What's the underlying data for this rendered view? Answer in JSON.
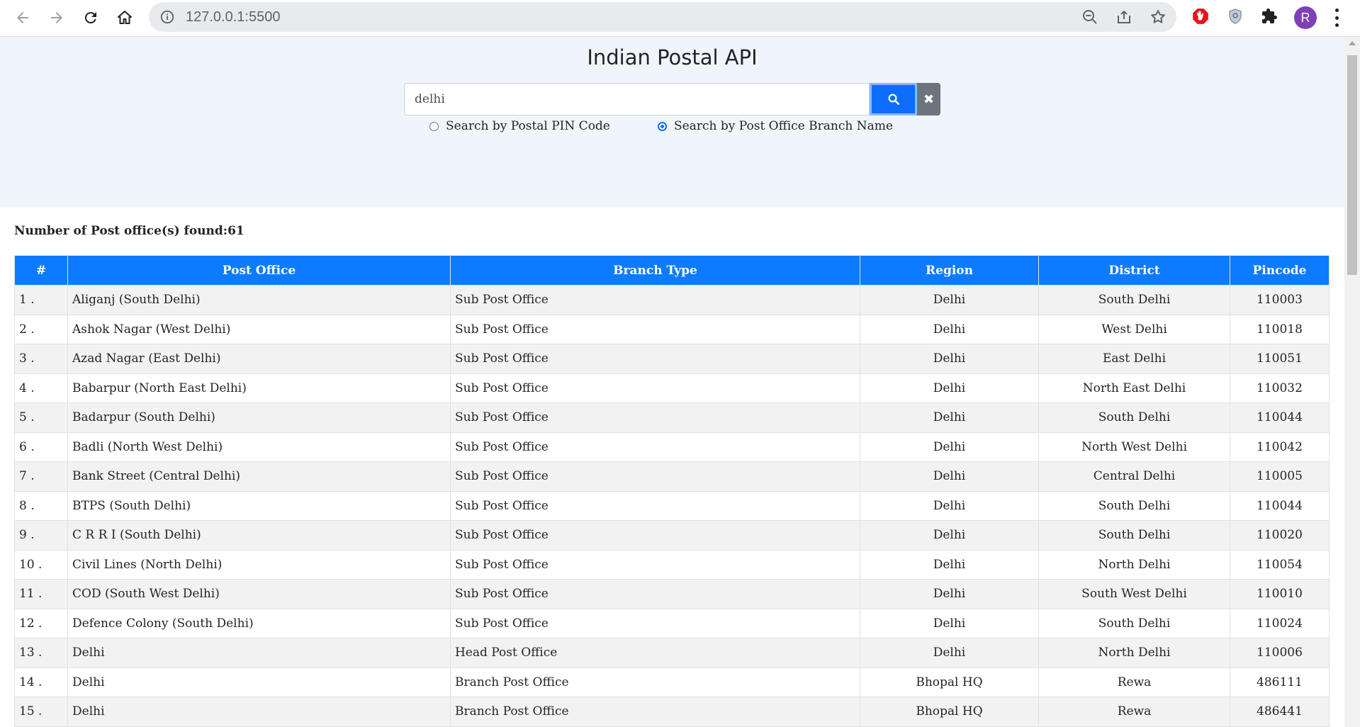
{
  "browser": {
    "url": "127.0.0.1:5500",
    "profile_initial": "R"
  },
  "page": {
    "title": "Indian Postal API",
    "search": {
      "value": "delhi",
      "radio_pin_label": "Search by Postal PIN Code",
      "radio_name_label": "Search by Post Office Branch Name",
      "selected": "name"
    },
    "results_label": "Number of Post office(s) found:",
    "results_count": "61",
    "table": {
      "headers": [
        "#",
        "Post Office",
        "Branch Type",
        "Region",
        "District",
        "Pincode"
      ],
      "rows": [
        [
          "1 .",
          "Aliganj (South Delhi)",
          "Sub Post Office",
          "Delhi",
          "South Delhi",
          "110003"
        ],
        [
          "2 .",
          "Ashok Nagar (West Delhi)",
          "Sub Post Office",
          "Delhi",
          "West Delhi",
          "110018"
        ],
        [
          "3 .",
          "Azad Nagar (East Delhi)",
          "Sub Post Office",
          "Delhi",
          "East Delhi",
          "110051"
        ],
        [
          "4 .",
          "Babarpur (North East Delhi)",
          "Sub Post Office",
          "Delhi",
          "North East Delhi",
          "110032"
        ],
        [
          "5 .",
          "Badarpur (South Delhi)",
          "Sub Post Office",
          "Delhi",
          "South Delhi",
          "110044"
        ],
        [
          "6 .",
          "Badli (North West Delhi)",
          "Sub Post Office",
          "Delhi",
          "North West Delhi",
          "110042"
        ],
        [
          "7 .",
          "Bank Street (Central Delhi)",
          "Sub Post Office",
          "Delhi",
          "Central Delhi",
          "110005"
        ],
        [
          "8 .",
          "BTPS (South Delhi)",
          "Sub Post Office",
          "Delhi",
          "South Delhi",
          "110044"
        ],
        [
          "9 .",
          "C R R I (South Delhi)",
          "Sub Post Office",
          "Delhi",
          "South Delhi",
          "110020"
        ],
        [
          "10 .",
          "Civil Lines (North Delhi)",
          "Sub Post Office",
          "Delhi",
          "North Delhi",
          "110054"
        ],
        [
          "11 .",
          "COD (South West Delhi)",
          "Sub Post Office",
          "Delhi",
          "South West Delhi",
          "110010"
        ],
        [
          "12 .",
          "Defence Colony (South Delhi)",
          "Sub Post Office",
          "Delhi",
          "South Delhi",
          "110024"
        ],
        [
          "13 .",
          "Delhi",
          "Head Post Office",
          "Delhi",
          "North Delhi",
          "110006"
        ],
        [
          "14 .",
          "Delhi",
          "Branch Post Office",
          "Bhopal HQ",
          "Rewa",
          "486111"
        ],
        [
          "15 .",
          "Delhi",
          "Branch Post Office",
          "Bhopal HQ",
          "Rewa",
          "486441"
        ]
      ]
    }
  },
  "colors": {
    "primary": "#0d6efd",
    "header_bg": "#0d7bff",
    "hero_bg": "#f0f5fb",
    "clear_btn": "#6c757d"
  }
}
